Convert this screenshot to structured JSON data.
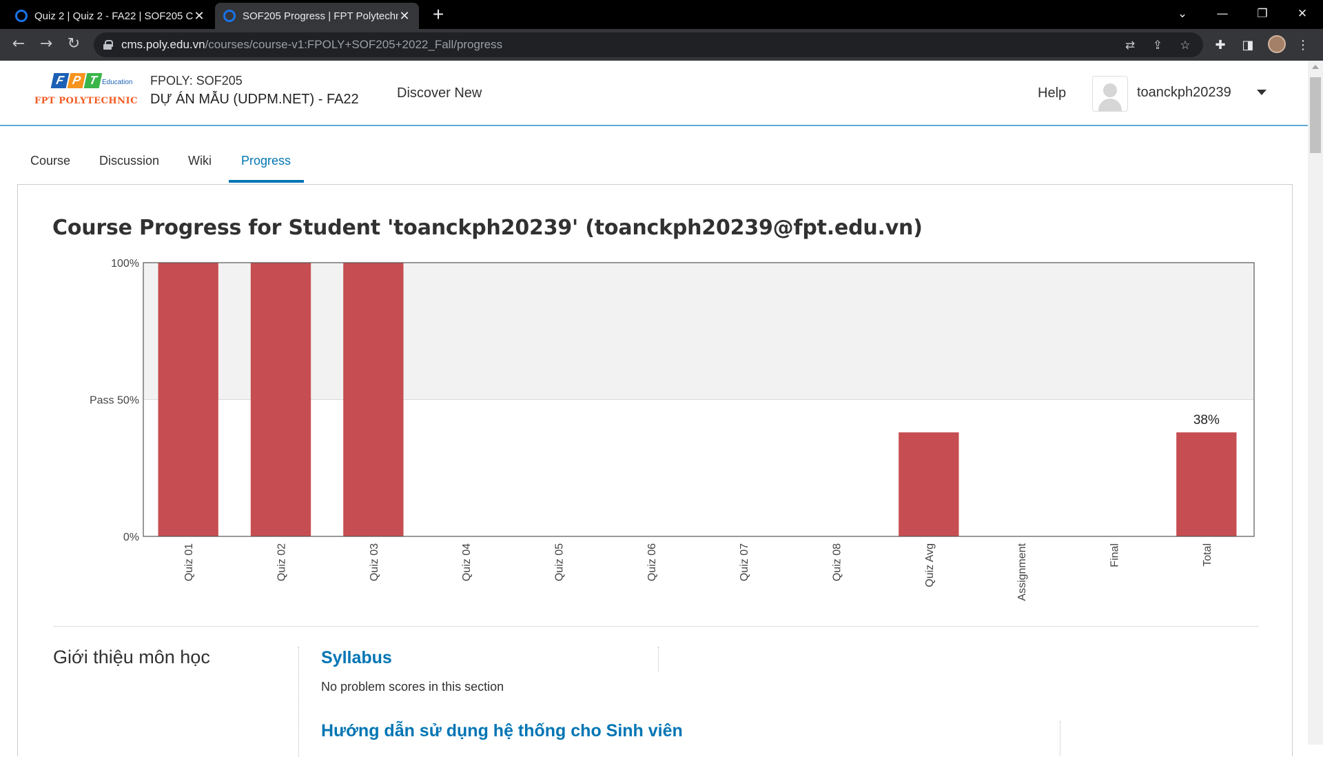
{
  "browser": {
    "tabs": [
      {
        "title": "Quiz 2 | Quiz 2 - FA22 | SOF205 C",
        "active": false
      },
      {
        "title": "SOF205 Progress | FPT Polytechni",
        "active": true
      }
    ],
    "new_tab": "+",
    "url_host": "cms.poly.edu.vn",
    "url_path": "/courses/course-v1:FPOLY+SOF205+2022_Fall/progress"
  },
  "header": {
    "logo_letters": [
      "F",
      "P",
      "T"
    ],
    "logo_edu": "Education",
    "logo_name": "FPT POLYTECHNIC",
    "course_org": "FPOLY: SOF205",
    "course_name": "DỰ ÁN MẪU (UDPM.NET) - FA22",
    "discover": "Discover New",
    "help": "Help",
    "username": "toanckph20239"
  },
  "nav_tabs": [
    {
      "label": "Course",
      "active": false
    },
    {
      "label": "Discussion",
      "active": false
    },
    {
      "label": "Wiki",
      "active": false
    },
    {
      "label": "Progress",
      "active": true
    }
  ],
  "page_title": "Course Progress for Student 'toanckph20239' (toanckph20239@fpt.edu.vn)",
  "chart_data": {
    "type": "bar",
    "categories": [
      "Quiz 01",
      "Quiz 02",
      "Quiz 03",
      "Quiz 04",
      "Quiz 05",
      "Quiz 06",
      "Quiz 07",
      "Quiz 08",
      "Quiz Avg",
      "Assignment",
      "Final",
      "Total"
    ],
    "values": [
      100,
      100,
      100,
      0,
      0,
      0,
      0,
      0,
      38,
      0,
      0,
      38
    ],
    "ylim": [
      0,
      100
    ],
    "yticks": [
      {
        "value": 0,
        "label": "0%"
      },
      {
        "value": 50,
        "label": "Pass 50%"
      },
      {
        "value": 100,
        "label": "100%"
      }
    ],
    "pass_threshold": 50,
    "annotations": [
      {
        "category": "Total",
        "label": "38%"
      }
    ],
    "bar_color": "#c64d51",
    "pass_band_color": "#f2f2f2"
  },
  "sections": {
    "chapter_title": "Giới thiệu môn học",
    "items": [
      {
        "title": "Syllabus",
        "text": "No problem scores in this section"
      },
      {
        "title": "Hướng dẫn sử dụng hệ thống cho Sinh viên"
      }
    ]
  },
  "colors": {
    "link": "#0075b4",
    "header_border": "#5ea9d6",
    "logo_f": "#1b60b4",
    "logo_p": "#f7941d",
    "logo_t": "#39b54a",
    "logo_orange": "#f15a22"
  }
}
